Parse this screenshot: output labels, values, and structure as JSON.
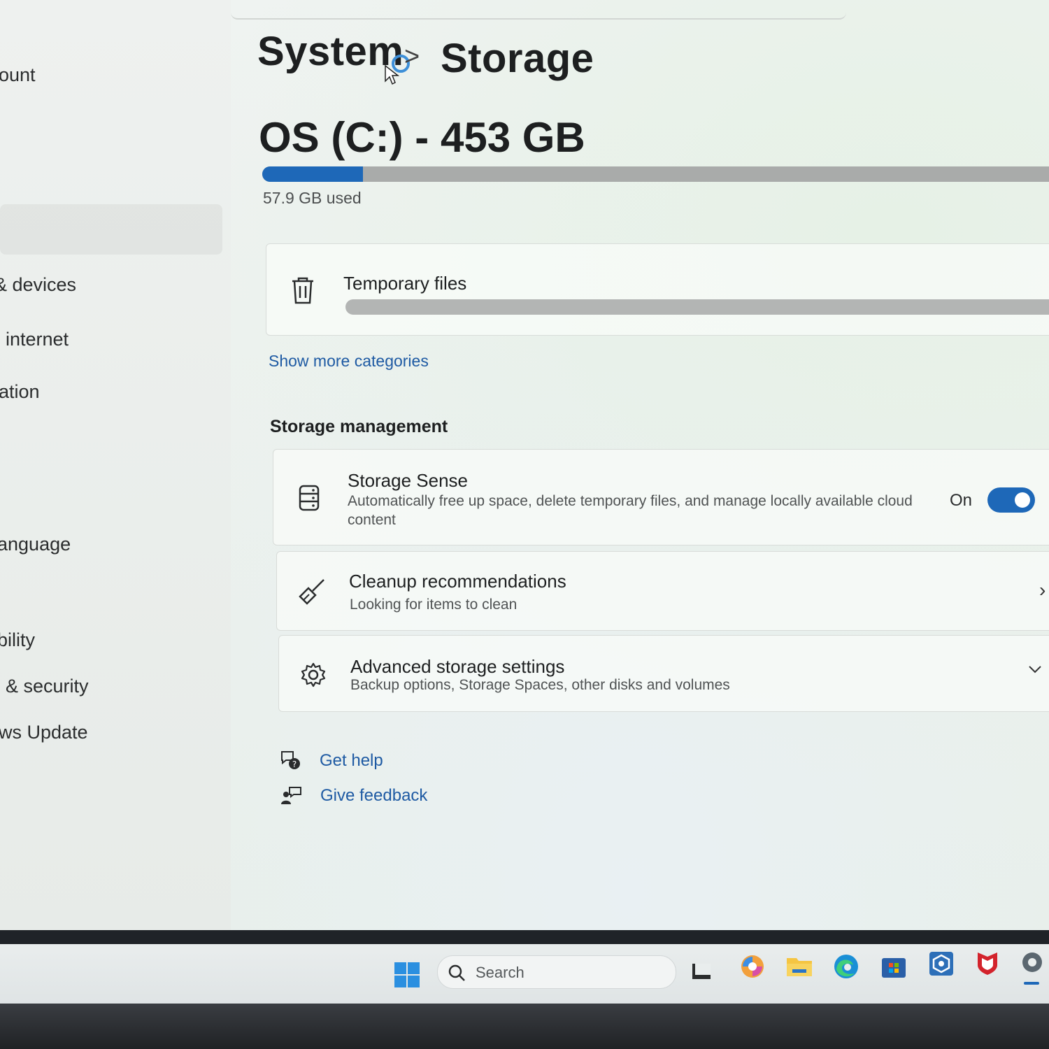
{
  "sidebar": {
    "items": [
      {
        "label": "ount"
      },
      {
        "label": "& devices"
      },
      {
        "label": "internet"
      },
      {
        "label": "ation"
      },
      {
        "label": "anguage"
      },
      {
        "label": "bility"
      },
      {
        "label": "& security"
      },
      {
        "label": "ws Update"
      }
    ]
  },
  "header": {
    "breadcrumb_parent": "System",
    "breadcrumb_separator": ">",
    "breadcrumb_current": "Storage"
  },
  "drive": {
    "title": "OS (C:) - 453 GB",
    "used_label": "57.9 GB used",
    "used_fraction": 0.128
  },
  "categories": {
    "temporary_files": {
      "label": "Temporary files",
      "icon": "trash-icon"
    },
    "show_more": "Show more categories"
  },
  "storage_management": {
    "heading": "Storage management",
    "storage_sense": {
      "title": "Storage Sense",
      "description": "Automatically free up space, delete temporary files, and manage locally available cloud content",
      "toggle_label": "On",
      "toggle_on": true,
      "icon": "storage-drive-icon"
    },
    "cleanup": {
      "title": "Cleanup recommendations",
      "description": "Looking for items to clean",
      "icon": "broom-icon"
    },
    "advanced": {
      "title": "Advanced storage settings",
      "description": "Backup options, Storage Spaces, other disks and volumes",
      "icon": "gear-icon"
    }
  },
  "footer": {
    "get_help": "Get help",
    "give_feedback": "Give feedback"
  },
  "taskbar": {
    "search_placeholder": "Search",
    "icons": [
      "windows-start-icon",
      "search-icon",
      "task-view-icon",
      "copilot-icon",
      "file-explorer-icon",
      "edge-icon",
      "microsoft-store-icon",
      "app-icon",
      "mcafee-icon",
      "settings-icon"
    ]
  },
  "colors": {
    "accent": "#1e68b8",
    "link": "#1e5aa3"
  }
}
